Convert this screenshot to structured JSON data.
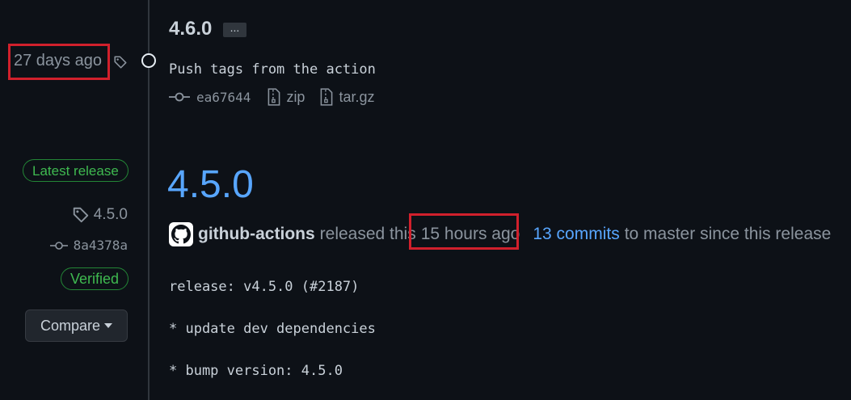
{
  "left": {
    "older_release_date": "27 days ago",
    "latest_badge": "Latest release",
    "tag": "4.5.0",
    "commit": "8a4378a",
    "verified": "Verified",
    "compare_label": "Compare"
  },
  "release_old": {
    "title": "4.6.0",
    "ellipsis": "...",
    "description": "Push tags from the action",
    "commit": "ea67644",
    "assets": [
      "zip",
      "tar.gz"
    ]
  },
  "release_latest": {
    "title": "4.5.0",
    "author": "github-actions",
    "released_text": "released this",
    "time": "15 hours ago",
    "commits_link": "13 commits",
    "commits_suffix": "to master since this release",
    "body": [
      "release: v4.5.0 (#2187)",
      "* update dev dependencies",
      "* bump version: 4.5.0"
    ]
  },
  "colors": {
    "background": "#0d1117",
    "link": "#58a6ff",
    "success": "#3fb950",
    "highlight": "#d1202c"
  },
  "icons": [
    "tag-icon",
    "commit-icon",
    "zip-file-icon",
    "github-logo-icon",
    "caret-down-icon"
  ]
}
